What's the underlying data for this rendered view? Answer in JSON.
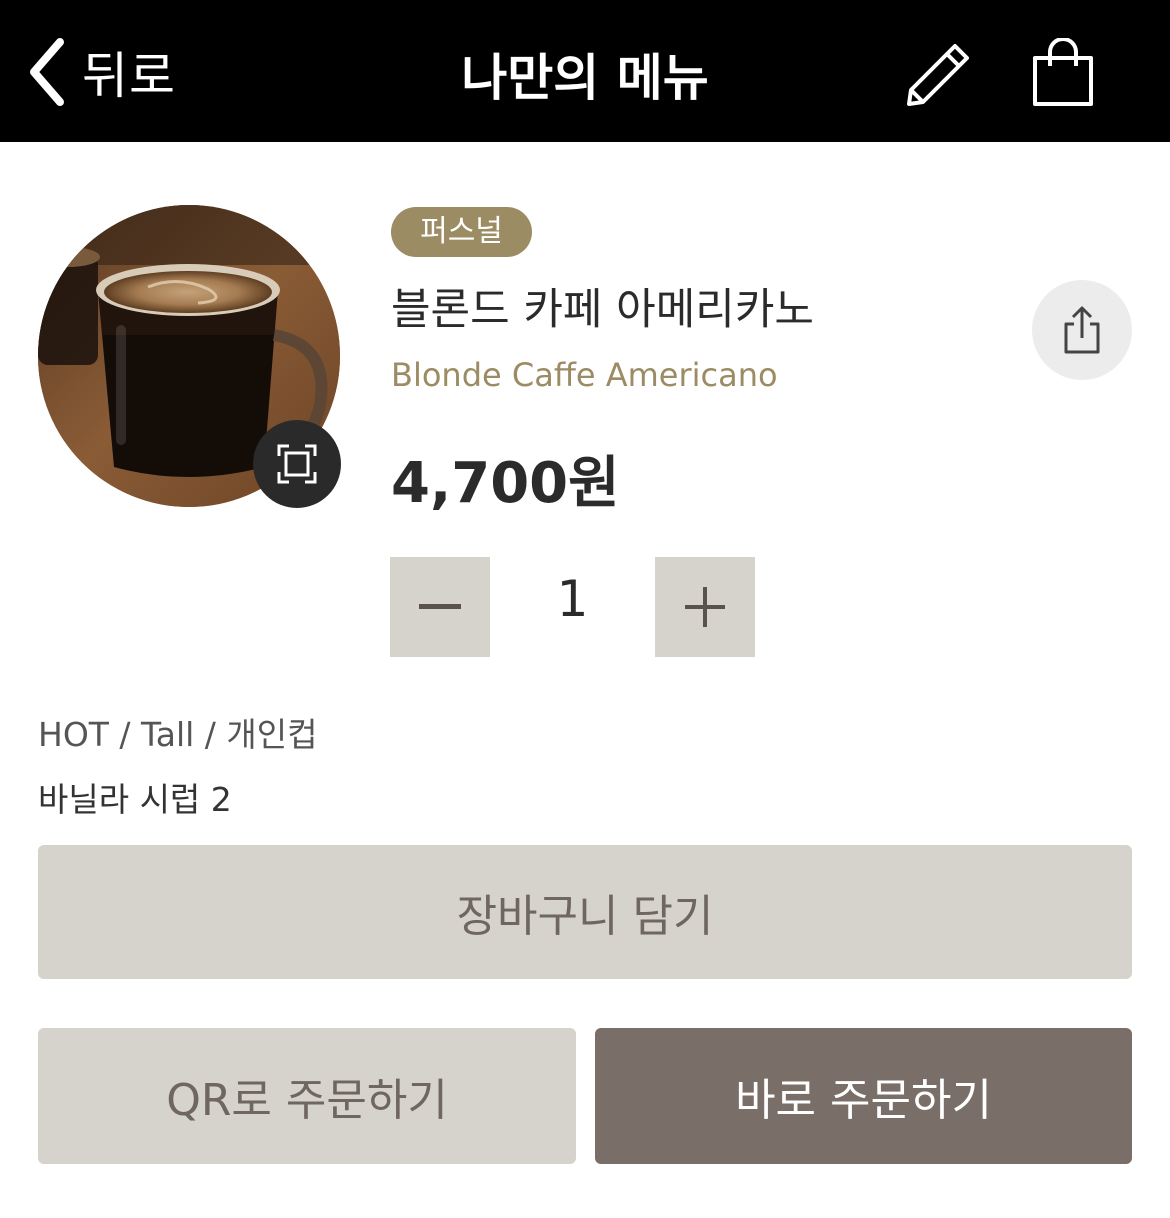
{
  "header": {
    "back_label": "뒤로",
    "title": "나만의 메뉴",
    "icons": [
      "chevron-left-icon",
      "pencil-icon",
      "shopping-bag-icon"
    ]
  },
  "product": {
    "badge": "퍼스널",
    "name_ko": "블론드 카페 아메리카노",
    "name_en": "Blonde Caffe Americano",
    "price": "4,700원",
    "image": "americano-photo",
    "icons": [
      "zoom-expand-icon",
      "share-icon"
    ]
  },
  "quantity": {
    "value": "1",
    "minus_icon": "minus-icon",
    "plus_icon": "plus-icon"
  },
  "options": {
    "line1": "HOT / Tall / 개인컵",
    "line2": "바닐라 시럽 2"
  },
  "actions": {
    "cart_label": "장바구니 담기",
    "qr_label": "QR로 주문하기",
    "order_label": "바로 주문하기"
  },
  "colors": {
    "header_bg": "#000000",
    "accent_gold": "#9c8c63",
    "button_light": "#d6d2cc",
    "button_dark": "#7a6e68"
  }
}
